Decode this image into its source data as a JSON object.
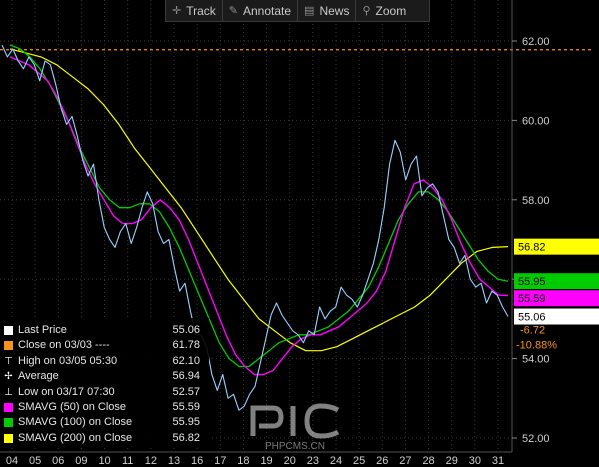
{
  "toolbar": {
    "track": "Track",
    "annotate": "Annotate",
    "news": "News",
    "zoom": "Zoom",
    "track_icon": "crosshair-icon",
    "annotate_icon": "pen-icon",
    "news_icon": "newspaper-icon",
    "zoom_icon": "magnifier-icon"
  },
  "legend": [
    {
      "label": "Last Price",
      "value": "55.06",
      "swatch": "#ffffff",
      "icon": "square"
    },
    {
      "label": "Close on 03/03 ----",
      "value": "61.78",
      "swatch": "#f7941d",
      "icon": "square"
    },
    {
      "label": "High on 03/05 05:30",
      "value": "62.10",
      "swatch": "#ffffff",
      "icon": "high-marker"
    },
    {
      "label": "Average",
      "value": "56.94",
      "swatch": "#ffffff",
      "icon": "average-marker"
    },
    {
      "label": "Low on 03/17 07:30",
      "value": "52.57",
      "swatch": "#ffffff",
      "icon": "low-marker"
    },
    {
      "label": "SMAVG (50) on Close",
      "value": "55.59",
      "swatch": "#ff00ff",
      "icon": "square"
    },
    {
      "label": "SMAVG (100) on Close",
      "value": "55.95",
      "swatch": "#00cc00",
      "icon": "square"
    },
    {
      "label": "SMAVG (200) on Close",
      "value": "56.82",
      "swatch": "#ffff00",
      "icon": "square"
    }
  ],
  "price_tags": {
    "sma200": "56.82",
    "sma100": "55.95",
    "sma50": "55.59",
    "last": "55.06",
    "change": "-6.72",
    "change_pct": "-10.88%"
  },
  "watermark": {
    "text": "PHPCMS.CN"
  },
  "colors": {
    "background": "#000000",
    "price": "#6aaee8",
    "price_highlight": "#ffffff",
    "sma50": "#ff00ff",
    "sma100": "#00cc00",
    "sma200": "#ffff00",
    "close_ref": "#f7941d",
    "grid": "#3a3a3a",
    "axis_text": "#d0d0d0",
    "negative": "#f7941d"
  },
  "chart_data": {
    "type": "line",
    "title": "",
    "xlabel": "",
    "ylabel": "",
    "ylim": [
      51.8,
      62.6
    ],
    "yticks": [
      "52.00",
      "54.00",
      "56.00",
      "58.00",
      "60.00",
      "62.00"
    ],
    "x_tick_labels": [
      "04",
      "05",
      "06",
      "09",
      "10",
      "11",
      "12",
      "13",
      "16",
      "17",
      "18",
      "19",
      "20",
      "23",
      "24",
      "25",
      "26",
      "27",
      "28",
      "29",
      "30",
      "31"
    ],
    "reference_line": {
      "name": "Close on 03/03",
      "value": 61.78
    },
    "series": [
      {
        "name": "Last Price",
        "values": [
          61.9,
          61.6,
          61.8,
          61.5,
          61.3,
          61.6,
          61.4,
          61.0,
          61.5,
          61.4,
          60.9,
          60.3,
          59.9,
          60.1,
          59.6,
          59.0,
          58.6,
          58.9,
          58.0,
          57.3,
          57.0,
          56.8,
          57.2,
          57.4,
          56.9,
          57.3,
          57.8,
          58.2,
          57.9,
          57.2,
          56.9,
          57.0,
          56.3,
          55.7,
          55.9,
          55.2,
          54.6,
          54.6,
          54.3,
          53.6,
          53.2,
          53.6,
          53.0,
          53.1,
          52.7,
          52.8,
          53.1,
          53.3,
          53.9,
          54.5,
          55.1,
          55.4,
          55.1,
          54.9,
          54.7,
          54.6,
          54.4,
          54.7,
          54.6,
          55.3,
          55.0,
          55.2,
          55.3,
          55.8,
          55.6,
          55.5,
          55.3,
          55.6,
          56.0,
          56.4,
          57.0,
          57.8,
          58.9,
          59.5,
          59.2,
          58.5,
          58.9,
          59.1,
          58.1,
          58.3,
          58.4,
          58.2,
          57.6,
          57.0,
          56.8,
          56.4,
          56.6,
          56.0,
          55.8,
          55.9,
          55.4,
          55.7,
          55.6,
          55.3,
          55.06
        ]
      },
      {
        "name": "SMAVG (50) on Close",
        "values": [
          61.6,
          61.5,
          61.4,
          61.2,
          61.0,
          60.6,
          60.1,
          59.5,
          58.9,
          58.4,
          58.0,
          57.6,
          57.4,
          57.4,
          57.5,
          57.8,
          58.0,
          57.8,
          57.5,
          57.0,
          56.4,
          55.8,
          55.2,
          54.6,
          54.1,
          53.8,
          53.6,
          53.6,
          53.7,
          54.0,
          54.3,
          54.5,
          54.6,
          54.6,
          54.7,
          54.8,
          55.0,
          55.2,
          55.4,
          55.7,
          56.2,
          57.0,
          57.8,
          58.4,
          58.5,
          58.3,
          58.0,
          57.5,
          56.9,
          56.4,
          56.0,
          55.8,
          55.6,
          55.59
        ]
      },
      {
        "name": "SMAVG (100) on Close",
        "values": [
          61.9,
          61.8,
          61.6,
          61.3,
          60.9,
          60.4,
          59.9,
          59.3,
          58.8,
          58.3,
          58.0,
          57.8,
          57.8,
          57.9,
          57.9,
          57.7,
          57.3,
          56.8,
          56.2,
          55.6,
          55.0,
          54.4,
          54.0,
          53.8,
          53.8,
          54.0,
          54.2,
          54.4,
          54.5,
          54.6,
          54.6,
          54.7,
          54.8,
          55.0,
          55.2,
          55.5,
          55.8,
          56.3,
          56.9,
          57.5,
          57.9,
          58.2,
          58.2,
          58.0,
          57.7,
          57.3,
          56.9,
          56.5,
          56.2,
          56.0,
          55.95
        ]
      },
      {
        "name": "SMAVG (200) on Close",
        "values": [
          61.8,
          61.7,
          61.6,
          61.4,
          61.1,
          60.8,
          60.4,
          59.9,
          59.3,
          58.8,
          58.3,
          57.8,
          57.2,
          56.6,
          56.0,
          55.5,
          55.0,
          54.7,
          54.4,
          54.2,
          54.2,
          54.3,
          54.5,
          54.7,
          54.9,
          55.1,
          55.3,
          55.6,
          56.0,
          56.4,
          56.7,
          56.8,
          56.82
        ]
      }
    ]
  }
}
